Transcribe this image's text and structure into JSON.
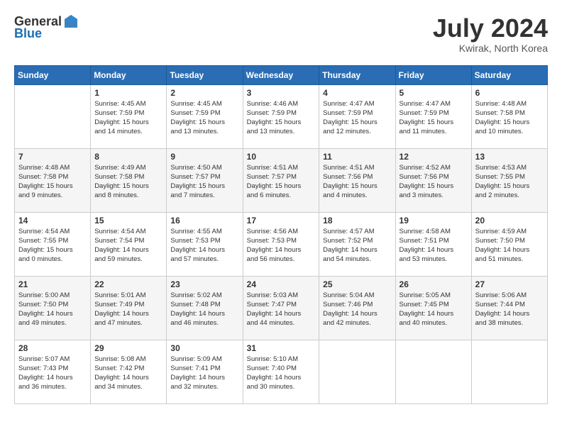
{
  "header": {
    "logo_general": "General",
    "logo_blue": "Blue",
    "month_year": "July 2024",
    "location": "Kwirak, North Korea"
  },
  "calendar": {
    "columns": [
      "Sunday",
      "Monday",
      "Tuesday",
      "Wednesday",
      "Thursday",
      "Friday",
      "Saturday"
    ],
    "weeks": [
      [
        {
          "day": "",
          "info": ""
        },
        {
          "day": "1",
          "info": "Sunrise: 4:45 AM\nSunset: 7:59 PM\nDaylight: 15 hours\nand 14 minutes."
        },
        {
          "day": "2",
          "info": "Sunrise: 4:45 AM\nSunset: 7:59 PM\nDaylight: 15 hours\nand 13 minutes."
        },
        {
          "day": "3",
          "info": "Sunrise: 4:46 AM\nSunset: 7:59 PM\nDaylight: 15 hours\nand 13 minutes."
        },
        {
          "day": "4",
          "info": "Sunrise: 4:47 AM\nSunset: 7:59 PM\nDaylight: 15 hours\nand 12 minutes."
        },
        {
          "day": "5",
          "info": "Sunrise: 4:47 AM\nSunset: 7:59 PM\nDaylight: 15 hours\nand 11 minutes."
        },
        {
          "day": "6",
          "info": "Sunrise: 4:48 AM\nSunset: 7:58 PM\nDaylight: 15 hours\nand 10 minutes."
        }
      ],
      [
        {
          "day": "7",
          "info": "Sunrise: 4:48 AM\nSunset: 7:58 PM\nDaylight: 15 hours\nand 9 minutes."
        },
        {
          "day": "8",
          "info": "Sunrise: 4:49 AM\nSunset: 7:58 PM\nDaylight: 15 hours\nand 8 minutes."
        },
        {
          "day": "9",
          "info": "Sunrise: 4:50 AM\nSunset: 7:57 PM\nDaylight: 15 hours\nand 7 minutes."
        },
        {
          "day": "10",
          "info": "Sunrise: 4:51 AM\nSunset: 7:57 PM\nDaylight: 15 hours\nand 6 minutes."
        },
        {
          "day": "11",
          "info": "Sunrise: 4:51 AM\nSunset: 7:56 PM\nDaylight: 15 hours\nand 4 minutes."
        },
        {
          "day": "12",
          "info": "Sunrise: 4:52 AM\nSunset: 7:56 PM\nDaylight: 15 hours\nand 3 minutes."
        },
        {
          "day": "13",
          "info": "Sunrise: 4:53 AM\nSunset: 7:55 PM\nDaylight: 15 hours\nand 2 minutes."
        }
      ],
      [
        {
          "day": "14",
          "info": "Sunrise: 4:54 AM\nSunset: 7:55 PM\nDaylight: 15 hours\nand 0 minutes."
        },
        {
          "day": "15",
          "info": "Sunrise: 4:54 AM\nSunset: 7:54 PM\nDaylight: 14 hours\nand 59 minutes."
        },
        {
          "day": "16",
          "info": "Sunrise: 4:55 AM\nSunset: 7:53 PM\nDaylight: 14 hours\nand 57 minutes."
        },
        {
          "day": "17",
          "info": "Sunrise: 4:56 AM\nSunset: 7:53 PM\nDaylight: 14 hours\nand 56 minutes."
        },
        {
          "day": "18",
          "info": "Sunrise: 4:57 AM\nSunset: 7:52 PM\nDaylight: 14 hours\nand 54 minutes."
        },
        {
          "day": "19",
          "info": "Sunrise: 4:58 AM\nSunset: 7:51 PM\nDaylight: 14 hours\nand 53 minutes."
        },
        {
          "day": "20",
          "info": "Sunrise: 4:59 AM\nSunset: 7:50 PM\nDaylight: 14 hours\nand 51 minutes."
        }
      ],
      [
        {
          "day": "21",
          "info": "Sunrise: 5:00 AM\nSunset: 7:50 PM\nDaylight: 14 hours\nand 49 minutes."
        },
        {
          "day": "22",
          "info": "Sunrise: 5:01 AM\nSunset: 7:49 PM\nDaylight: 14 hours\nand 47 minutes."
        },
        {
          "day": "23",
          "info": "Sunrise: 5:02 AM\nSunset: 7:48 PM\nDaylight: 14 hours\nand 46 minutes."
        },
        {
          "day": "24",
          "info": "Sunrise: 5:03 AM\nSunset: 7:47 PM\nDaylight: 14 hours\nand 44 minutes."
        },
        {
          "day": "25",
          "info": "Sunrise: 5:04 AM\nSunset: 7:46 PM\nDaylight: 14 hours\nand 42 minutes."
        },
        {
          "day": "26",
          "info": "Sunrise: 5:05 AM\nSunset: 7:45 PM\nDaylight: 14 hours\nand 40 minutes."
        },
        {
          "day": "27",
          "info": "Sunrise: 5:06 AM\nSunset: 7:44 PM\nDaylight: 14 hours\nand 38 minutes."
        }
      ],
      [
        {
          "day": "28",
          "info": "Sunrise: 5:07 AM\nSunset: 7:43 PM\nDaylight: 14 hours\nand 36 minutes."
        },
        {
          "day": "29",
          "info": "Sunrise: 5:08 AM\nSunset: 7:42 PM\nDaylight: 14 hours\nand 34 minutes."
        },
        {
          "day": "30",
          "info": "Sunrise: 5:09 AM\nSunset: 7:41 PM\nDaylight: 14 hours\nand 32 minutes."
        },
        {
          "day": "31",
          "info": "Sunrise: 5:10 AM\nSunset: 7:40 PM\nDaylight: 14 hours\nand 30 minutes."
        },
        {
          "day": "",
          "info": ""
        },
        {
          "day": "",
          "info": ""
        },
        {
          "day": "",
          "info": ""
        }
      ]
    ]
  }
}
